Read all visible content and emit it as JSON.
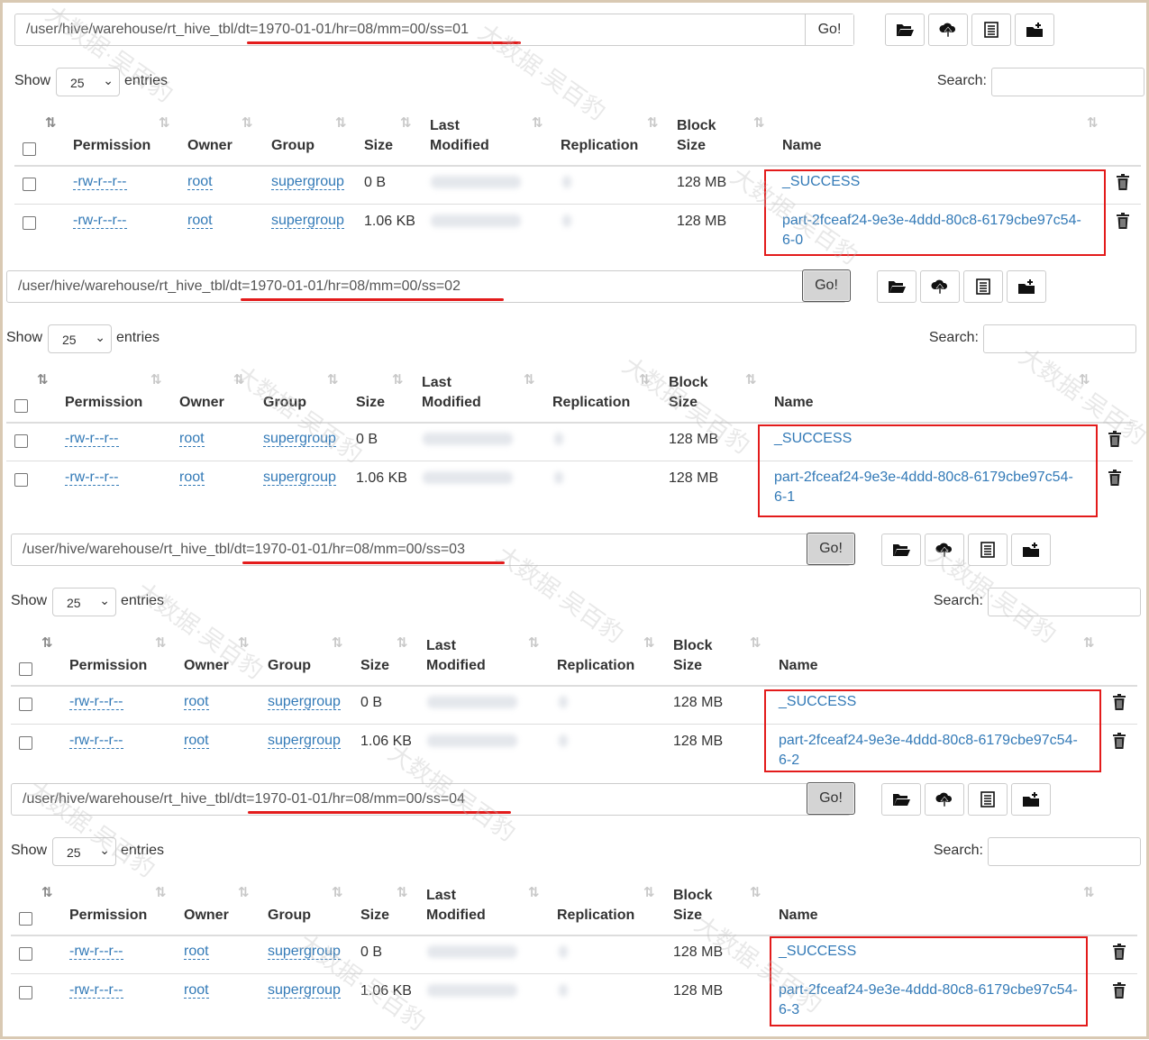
{
  "go_label": "Go!",
  "show_label": "Show",
  "entries_label": "entries",
  "search_label": "Search:",
  "page_size": "25",
  "columns": [
    "Permission",
    "Owner",
    "Group",
    "Size",
    "Last",
    "Modified",
    "Replication",
    "Block",
    "Size",
    "Name"
  ],
  "toolbar_icons": [
    "folder-open-icon",
    "upload-icon",
    "list-icon",
    "folder-add-icon"
  ],
  "colors": {
    "link": "#337ab7",
    "highlight": "#e31b1b"
  },
  "panels": [
    {
      "path": "/user/hive/warehouse/rt_hive_tbl/dt=1970-01-01/hr=08/mm=00/ss=01",
      "rows": [
        {
          "permission": "-rw-r--r--",
          "owner": "root",
          "group": "supergroup",
          "size": "0 B",
          "block_size": "128 MB",
          "name": "_SUCCESS",
          "name2": ""
        },
        {
          "permission": "-rw-r--r--",
          "owner": "root",
          "group": "supergroup",
          "size": "1.06 KB",
          "block_size": "128 MB",
          "name": "part-2fceaf24-9e3e-4ddd-80c8-6179cbe97c54-",
          "name2": "6-0"
        }
      ]
    },
    {
      "path": "/user/hive/warehouse/rt_hive_tbl/dt=1970-01-01/hr=08/mm=00/ss=02",
      "rows": [
        {
          "permission": "-rw-r--r--",
          "owner": "root",
          "group": "supergroup",
          "size": "0 B",
          "block_size": "128 MB",
          "name": "_SUCCESS",
          "name2": ""
        },
        {
          "permission": "-rw-r--r--",
          "owner": "root",
          "group": "supergroup",
          "size": "1.06 KB",
          "block_size": "128 MB",
          "name": "part-2fceaf24-9e3e-4ddd-80c8-6179cbe97c54-",
          "name2": "6-1"
        }
      ]
    },
    {
      "path": "/user/hive/warehouse/rt_hive_tbl/dt=1970-01-01/hr=08/mm=00/ss=03",
      "rows": [
        {
          "permission": "-rw-r--r--",
          "owner": "root",
          "group": "supergroup",
          "size": "0 B",
          "block_size": "128 MB",
          "name": "_SUCCESS",
          "name2": ""
        },
        {
          "permission": "-rw-r--r--",
          "owner": "root",
          "group": "supergroup",
          "size": "1.06 KB",
          "block_size": "128 MB",
          "name": "part-2fceaf24-9e3e-4ddd-80c8-6179cbe97c54-",
          "name2": "6-2"
        }
      ]
    },
    {
      "path": "/user/hive/warehouse/rt_hive_tbl/dt=1970-01-01/hr=08/mm=00/ss=04",
      "rows": [
        {
          "permission": "-rw-r--r--",
          "owner": "root",
          "group": "supergroup",
          "size": "0 B",
          "block_size": "128 MB",
          "name": "_SUCCESS",
          "name2": ""
        },
        {
          "permission": "-rw-r--r--",
          "owner": "root",
          "group": "supergroup",
          "size": "1.06 KB",
          "block_size": "128 MB",
          "name": "part-2fceaf24-9e3e-4ddd-80c8-6179cbe97c54-",
          "name2": "6-3"
        }
      ]
    }
  ]
}
